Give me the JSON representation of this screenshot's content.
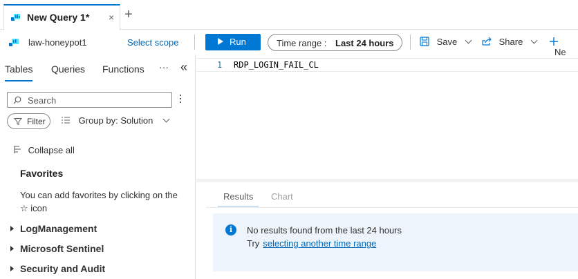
{
  "tabs": [
    {
      "label": "New Query 1*",
      "close": "×"
    }
  ],
  "add_tab": "+",
  "toolbar": {
    "workspace": "law-honeypot1",
    "select_scope": "Select scope",
    "run": "Run",
    "time_range_label": "Time range :",
    "time_range_value": "Last 24 hours",
    "save": "Save",
    "share": "Share",
    "new": "Ne"
  },
  "left_panel": {
    "tabs": [
      "Tables",
      "Queries",
      "Functions"
    ],
    "more": "···",
    "collapse_panel": "«",
    "search_placeholder": "Search",
    "filter": "Filter",
    "group_by": "Group by: Solution",
    "collapse_all": "Collapse all",
    "favorites_title": "Favorites",
    "favorites_text": "You can add favorites by clicking on the ☆ icon",
    "tree": [
      "LogManagement",
      "Microsoft Sentinel",
      "Security and Audit"
    ]
  },
  "editor": {
    "line_number": "1",
    "code": "RDP_LOGIN_FAIL_CL"
  },
  "results": {
    "tabs": [
      "Results",
      "Chart"
    ],
    "message": "No results found from the last 24 hours",
    "try": "Try",
    "link": "selecting another time range"
  },
  "colors": {
    "accent": "#0078d4",
    "link": "#0067b8",
    "info_bg": "#edf4fb"
  }
}
